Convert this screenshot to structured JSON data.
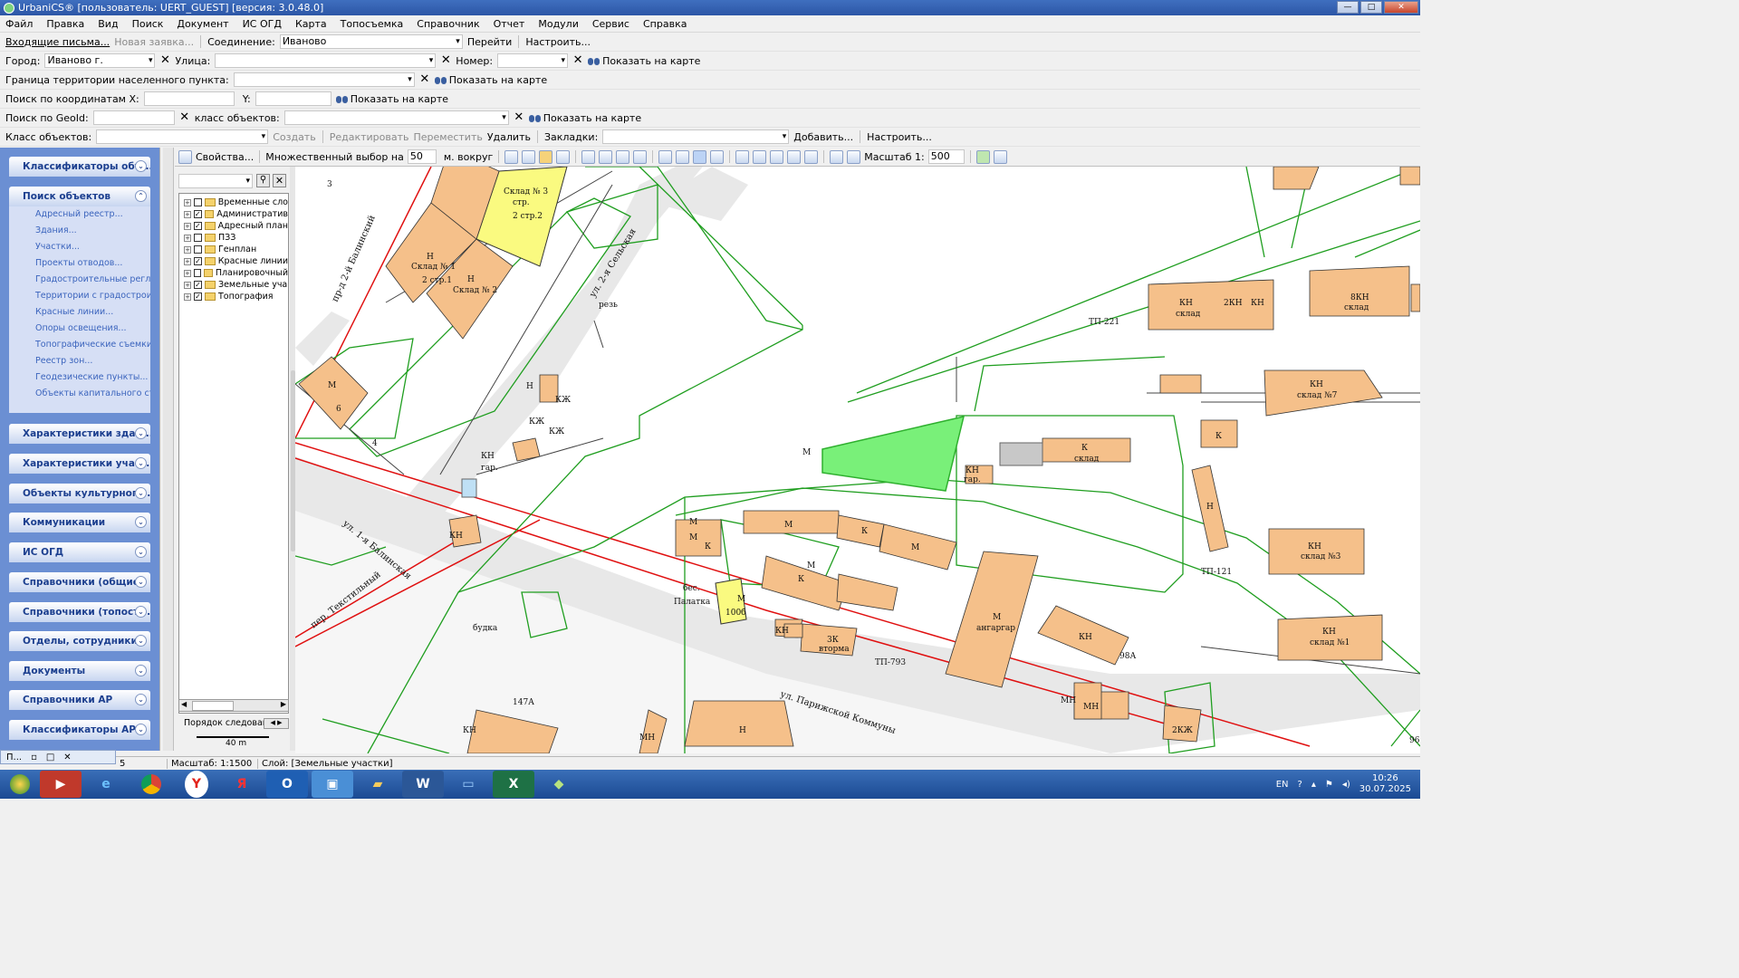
{
  "title": "UrbaniCS® [пользователь: UERT_GUEST] [версия: 3.0.48.0]",
  "menu": [
    "Файл",
    "Правка",
    "Вид",
    "Поиск",
    "Документ",
    "ИС ОГД",
    "Карта",
    "Топосъемка",
    "Справочник",
    "Отчет",
    "Модули",
    "Сервис",
    "Справка"
  ],
  "row1": {
    "inbox": "Входящие письма...",
    "new_request": "Новая заявка...",
    "connection_label": "Соединение:",
    "connection_value": "Иваново",
    "go": "Перейти",
    "setup": "Настроить..."
  },
  "row2": {
    "city_label": "Город:",
    "city_value": "Иваново г.",
    "street_label": "Улица:",
    "number_label": "Номер:",
    "show": "Показать на карте"
  },
  "row3": {
    "boundary_label": "Граница территории населенного пункта:",
    "show": "Показать на карте"
  },
  "row4": {
    "coords_label": "Поиск по координатам X:",
    "y_label": "Y:",
    "show": "Показать на карте"
  },
  "row5": {
    "geoid_label": "Поиск по GeoId:",
    "class_label": "класс объектов:",
    "show": "Показать на карте"
  },
  "row6": {
    "class_label": "Класс объектов:",
    "create": "Создать",
    "edit": "Редактировать",
    "move": "Переместить",
    "delete": "Удалить",
    "bookmarks": "Закладки:",
    "add": "Добавить...",
    "setup": "Настроить..."
  },
  "sidebar": {
    "sections": [
      "Классификаторы объ...",
      "Поиск объектов",
      "Характеристики здан...",
      "Характеристики участ...",
      "Объекты культурного ...",
      "Коммуникации",
      "ИС ОГД",
      "Справочники (общие)",
      "Справочники (топосъе...",
      "Отделы, сотрудники",
      "Документы",
      "Справочники АР",
      "Классификаторы АР"
    ],
    "items": [
      "Адресный реестр...",
      "Здания...",
      "Участки...",
      "Проекты отводов...",
      "Градостроительные реглам...",
      "Территории с градострoите...",
      "Красные линии...",
      "Опоры освещения...",
      "Топографические съемки...",
      "Реестр зон...",
      "Геодезические пункты...",
      "Объекты капитального стр..."
    ]
  },
  "tree": {
    "layers": [
      {
        "name": "Временные сло",
        "checked": false
      },
      {
        "name": "Административ",
        "checked": true
      },
      {
        "name": "Адресный план",
        "checked": true
      },
      {
        "name": "ПЗЗ",
        "checked": false
      },
      {
        "name": "Генплан",
        "checked": false
      },
      {
        "name": "Красные линии",
        "checked": true
      },
      {
        "name": "Планировочный",
        "checked": false
      },
      {
        "name": "Земельные уча",
        "checked": true
      },
      {
        "name": "Топография",
        "checked": true
      }
    ],
    "order_label": "Порядок следовани",
    "scale_bar": "40 m"
  },
  "map_toolbar": {
    "properties": "Свойства...",
    "multi_label": "Множественный выбор на",
    "multi_value": "50",
    "around": "м. вокруг",
    "scale_label": "Масштаб 1:",
    "scale_value": "500"
  },
  "map_labels": {
    "sklad3": "Склад № 3",
    "str": "стр.",
    "s2str2": "2 стр.2",
    "sklad1": "Склад № 1",
    "s2str1": "2 стр.1",
    "sklad2": "Склад № 2",
    "n": "Н",
    "m": "М",
    "k": "К",
    "kn": "КН",
    "kzh": "КЖ",
    "sklad": "склад",
    "angar": "ангаргар",
    "vtorma": "вторма",
    "palatka": "Палатка",
    "budka": "будка",
    "gar": "гар.",
    "street1": "ул. 2-я Сельская",
    "street2": "пр-д 2-й Балинский",
    "street3": "ул. 1-я Балинская",
    "street4": "ул. Парижской Коммуны",
    "street5": "пер. Текстильный",
    "n6": "6",
    "n4": "4",
    "n3": "3",
    "n147a": "147А",
    "n100b": "100б",
    "n98a": "98А",
    "n96": "96",
    "tp221": "ТП-221",
    "tp121": "ТП-121",
    "tp793": "ТП-793",
    "sklad7": "склад №7",
    "sklad3b": "склад №3",
    "sklad1b": "склад №1",
    "kn8": "8КН",
    "kn2": "2КН",
    "kzh2": "2КЖ",
    "k3": "3К",
    "mn": "МН",
    "res": "резь",
    "bes": "бес."
  },
  "status": {
    "page": "5",
    "scale": "Масштаб: 1:1500",
    "layer": "Слой: [Земельные участки]"
  },
  "taskbar": {
    "lang": "EN",
    "time": "10:26",
    "date": "30.07.2025",
    "mini": "П..."
  }
}
